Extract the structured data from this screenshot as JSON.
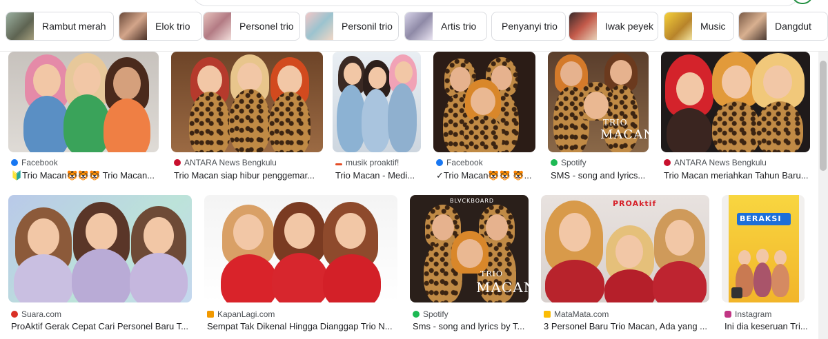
{
  "chips": [
    {
      "label": "Rambut merah",
      "thumb_color": "#8a8c7a"
    },
    {
      "label": "Elok trio",
      "thumb_color": "#b7785a"
    },
    {
      "label": "Personel trio",
      "thumb_color": "#c8a3a0"
    },
    {
      "label": "Personil trio",
      "thumb_color": "#d9b3b5"
    },
    {
      "label": "Artis trio",
      "thumb_color": "#b7b3c9"
    },
    {
      "label": "Penyanyi trio",
      "thumb_color": ""
    },
    {
      "label": "Iwak peyek",
      "thumb_color": "#b24a3a"
    },
    {
      "label": "Music",
      "thumb_color": "#e7c12e"
    },
    {
      "label": "Dangdut",
      "thumb_color": "#b58460"
    }
  ],
  "results_row1": [
    {
      "source": "Facebook",
      "source_color": "#1877f2",
      "title": "🔰Trio Macan🐯🐯🐯 Trio Macan..."
    },
    {
      "source": "ANTARA News Bengkulu",
      "source_color": "#c8102e",
      "title": "Trio Macan siap hibur penggemar..."
    },
    {
      "source": "musik proaktif!",
      "source_color": "#e44d26",
      "title": "Trio Macan - Medi..."
    },
    {
      "source": "Facebook",
      "source_color": "#1877f2",
      "title": "✓Trio Macan🐯🐯 🐯..."
    },
    {
      "source": "Spotify",
      "source_color": "#1db954",
      "title": "SMS - song and lyrics..."
    },
    {
      "source": "ANTARA News Bengkulu",
      "source_color": "#c8102e",
      "title": "Trio Macan meriahkan Tahun Baru..."
    }
  ],
  "results_row2": [
    {
      "source": "Suara.com",
      "source_color": "#d93025",
      "title": "ProAktif Gerak Cepat Cari Personel Baru T..."
    },
    {
      "source": "KapanLagi.com",
      "source_color": "#f29900",
      "title": "Sempat Tak Dikenal Hingga Dianggap Trio N..."
    },
    {
      "source": "Spotify",
      "source_color": "#1db954",
      "title": "Sms - song and lyrics by T..."
    },
    {
      "source": "MataMata.com",
      "source_color": "#fbbc04",
      "title": "3 Personel Baru Trio Macan, Ada yang ..."
    },
    {
      "source": "Instagram",
      "source_color": "#c13584",
      "title": "Ini dia keseruan Tri..."
    }
  ],
  "image_text": {
    "trio_macan_word1": "TRIO",
    "trio_macan_word2": "MACAN",
    "blackboard": "BLVCKBOARD",
    "beraksi": "BERAKSI",
    "proaktif": "PROAktif"
  }
}
